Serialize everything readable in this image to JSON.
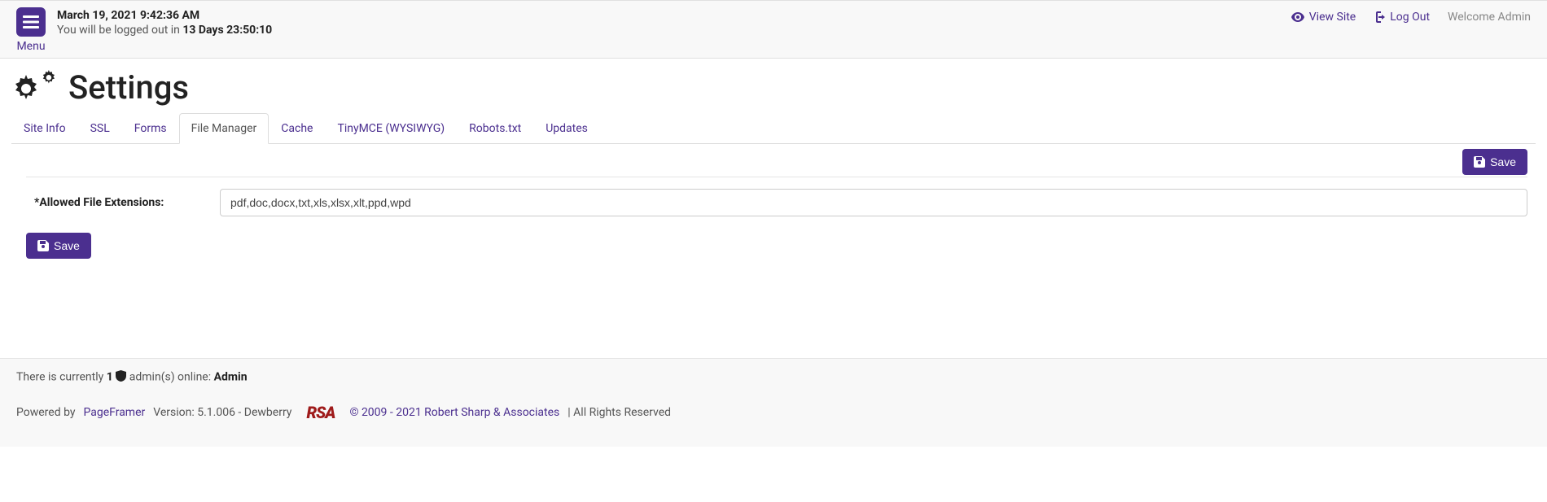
{
  "header": {
    "timestamp": "March 19, 2021 9:42:36 AM",
    "logout_prefix": "You will be logged out in ",
    "logout_countdown": "13 Days 23:50:10",
    "menu_label": "Menu",
    "view_site": "View Site",
    "log_out": "Log Out",
    "welcome": "Welcome Admin"
  },
  "page": {
    "title": "Settings"
  },
  "tabs": [
    {
      "label": "Site Info",
      "active": false
    },
    {
      "label": "SSL",
      "active": false
    },
    {
      "label": "Forms",
      "active": false
    },
    {
      "label": "File Manager",
      "active": true
    },
    {
      "label": "Cache",
      "active": false
    },
    {
      "label": "TinyMCE (WYSIWYG)",
      "active": false
    },
    {
      "label": "Robots.txt",
      "active": false
    },
    {
      "label": "Updates",
      "active": false
    }
  ],
  "form": {
    "allowed_ext_label": "*Allowed File Extensions:",
    "allowed_ext_value": "pdf,doc,docx,txt,xls,xlsx,xlt,ppd,wpd",
    "save_label": "Save"
  },
  "footer": {
    "online_prefix": "There is currently ",
    "online_count": "1",
    "online_mid": " admin(s) online: ",
    "online_name": "Admin",
    "powered_by": "Powered by ",
    "pageframer": "PageFramer",
    "version": " Version: 5.1.006 - Dewberry",
    "rsa": "RSA",
    "copyright": "© 2009 - 2021 Robert Sharp & Associates",
    "rights": " | All Rights Reserved"
  }
}
